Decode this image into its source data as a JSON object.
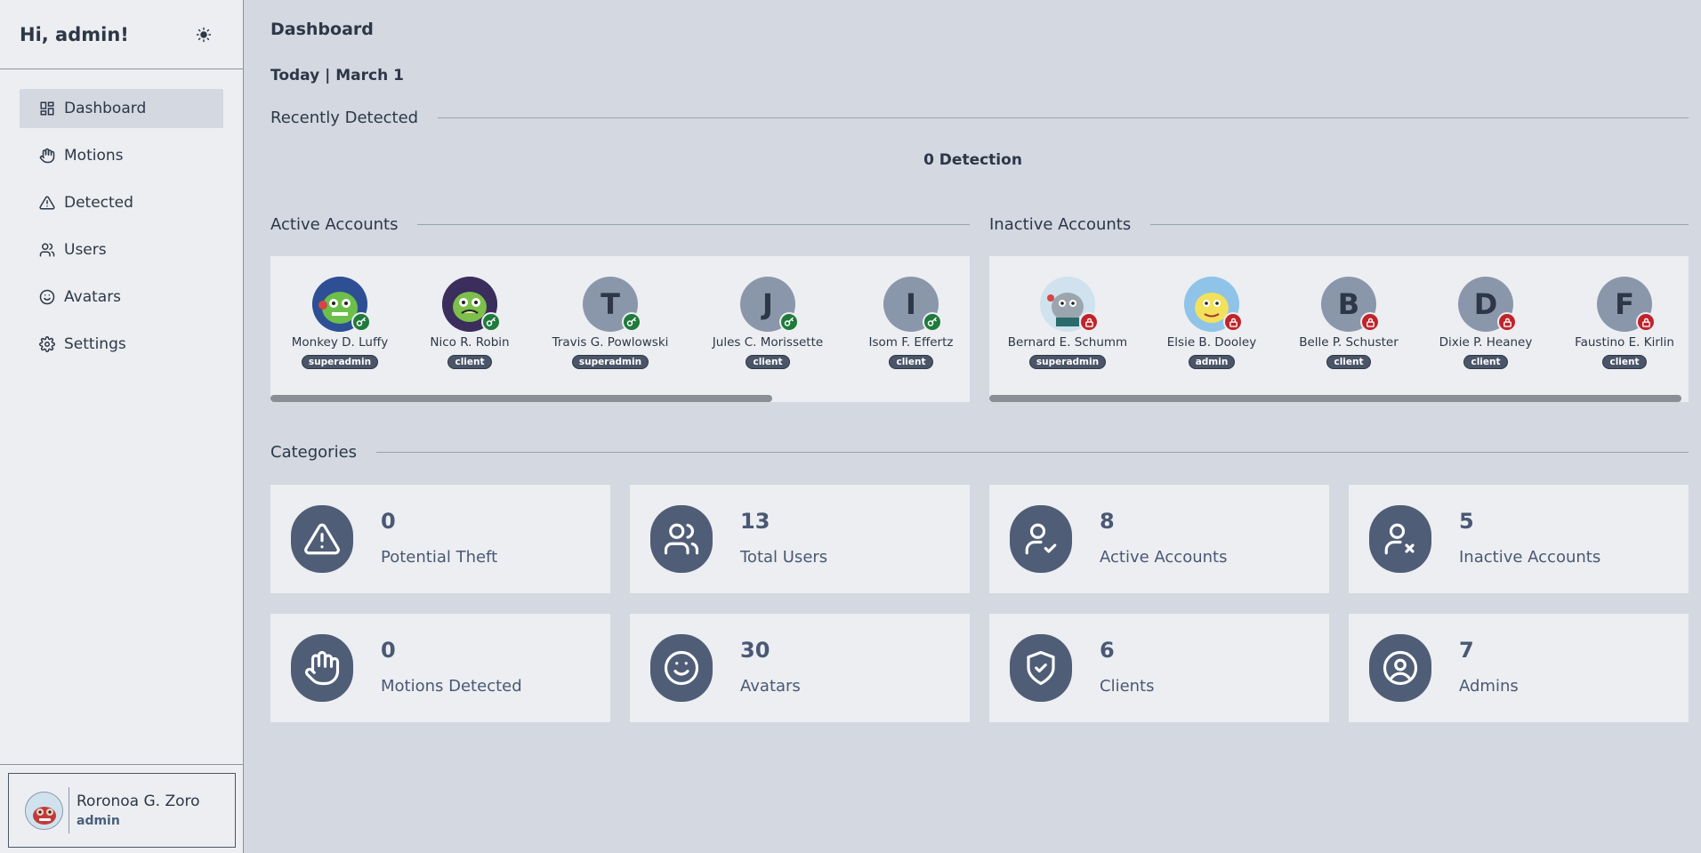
{
  "sidebar": {
    "greeting": "Hi, admin!",
    "theme_icon": "sun-icon",
    "nav": [
      {
        "label": "Dashboard",
        "icon": "dashboard-icon"
      },
      {
        "label": "Motions",
        "icon": "hand-icon"
      },
      {
        "label": "Detected",
        "icon": "warning-icon"
      },
      {
        "label": "Users",
        "icon": "users-icon"
      },
      {
        "label": "Avatars",
        "icon": "smile-icon"
      },
      {
        "label": "Settings",
        "icon": "gear-icon"
      }
    ],
    "user": {
      "name": "Roronoa G. Zoro",
      "role": "admin"
    }
  },
  "main": {
    "title": "Dashboard",
    "today": "Today | March 1",
    "recently_detected": "Recently Detected",
    "detection_count": "0 Detection",
    "active_accounts_title": "Active Accounts",
    "inactive_accounts_title": "Inactive Accounts",
    "active_accounts": [
      {
        "name": "Monkey D. Luffy",
        "role": "superadmin",
        "avatar": "image",
        "status_icon": "key-icon"
      },
      {
        "name": "Nico R. Robin",
        "role": "client",
        "avatar": "image",
        "status_icon": "key-icon"
      },
      {
        "name": "Travis G. Powlowski",
        "role": "superadmin",
        "initial": "T",
        "status_icon": "key-icon"
      },
      {
        "name": "Jules C. Morissette",
        "role": "client",
        "initial": "J",
        "status_icon": "key-icon"
      },
      {
        "name": "Isom F. Effertz",
        "role": "client",
        "initial": "I",
        "status_icon": "key-icon"
      }
    ],
    "inactive_accounts": [
      {
        "name": "Bernard E. Schumm",
        "role": "superadmin",
        "avatar": "image",
        "status_icon": "lock-icon"
      },
      {
        "name": "Elsie B. Dooley",
        "role": "admin",
        "avatar": "image",
        "status_icon": "lock-icon"
      },
      {
        "name": "Belle P. Schuster",
        "role": "client",
        "initial": "B",
        "status_icon": "lock-icon"
      },
      {
        "name": "Dixie P. Heaney",
        "role": "client",
        "initial": "D",
        "status_icon": "lock-icon"
      },
      {
        "name": "Faustino E. Kirlin",
        "role": "client",
        "initial": "F",
        "status_icon": "lock-icon"
      }
    ],
    "categories_title": "Categories",
    "categories": [
      {
        "value": "0",
        "label": "Potential Theft",
        "icon": "warning-icon"
      },
      {
        "value": "13",
        "label": "Total Users",
        "icon": "users-icon"
      },
      {
        "value": "8",
        "label": "Active Accounts",
        "icon": "user-check-icon"
      },
      {
        "value": "5",
        "label": "Inactive Accounts",
        "icon": "user-x-icon"
      },
      {
        "value": "0",
        "label": "Motions Detected",
        "icon": "hand-icon"
      },
      {
        "value": "30",
        "label": "Avatars",
        "icon": "smile-icon"
      },
      {
        "value": "6",
        "label": "Clients",
        "icon": "shield-check-icon"
      },
      {
        "value": "7",
        "label": "Admins",
        "icon": "user-circle-icon"
      }
    ]
  },
  "colors": {
    "background": "#d3d8e1",
    "panel": "#eceef1",
    "icon_circle": "#4f5d77",
    "active_badge": "#1f7a3b",
    "inactive_badge": "#c1232b"
  }
}
